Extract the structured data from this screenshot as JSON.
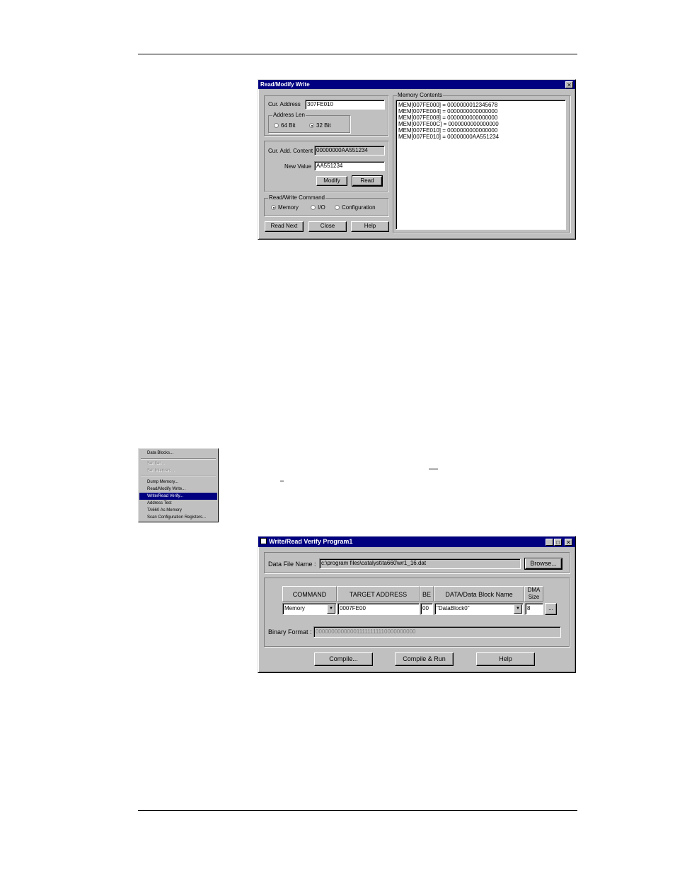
{
  "rwm": {
    "title": "Read/Modify Write",
    "close_glyph": "✕",
    "cur_address_label": "Cur. Address",
    "cur_address_value": "307FE010",
    "address_len_label": "Address Len",
    "radio_64": "64 Bit",
    "radio_32": "32 Bit",
    "cur_add_content_label": "Cur. Add. Content",
    "cur_add_content_value": "00000000AA551234",
    "new_value_label": "New Value",
    "new_value_value": "AA551234",
    "modify_label": "Modify",
    "read_label": "Read",
    "rw_command_label": "Read/Write Command",
    "radio_memory": "Memory",
    "radio_io": "I/O",
    "radio_config": "Configuration",
    "read_next_label": "Read Next",
    "close_label": "Close",
    "help_label": "Help",
    "memory_contents_label": "Memory Contents",
    "memory_lines": [
      "MEM[007FE000] = 0000000012345678",
      "MEM[007FE004] = 0000000000000000",
      "MEM[007FE008] = 0000000000000000",
      "MEM[007FE00C] = 0000000000000000",
      "MEM[007FE010] = 0000000000000000",
      "MEM[007FE010] = 00000000AA551234"
    ]
  },
  "menu": {
    "items": [
      "Data Blocks...",
      "Set Iter...",
      "Set Intervals...",
      "Dump Memory...",
      "Read/Modify Write...",
      "Write/Read Verify...",
      "Address Test",
      "TA660 As Memory",
      "Scan Configuration Registers..."
    ]
  },
  "wrv": {
    "title": "Write/Read Verify Program1",
    "min_glyph": "_",
    "max_glyph": "□",
    "close_glyph": "✕",
    "data_file_label": "Data File Name :",
    "data_file_value": "c:\\program files\\catalyst\\ta660\\wr1_16.dat",
    "browse_label": "Browse...",
    "col_command": "COMMAND",
    "col_target": "TARGET ADDRESS",
    "col_be": "BE",
    "col_data": "DATA/Data Block Name",
    "col_dma": "DMA Size",
    "command_value": "Memory",
    "target_value": "0007FE00",
    "be_value": "00",
    "data_value": "\"DataBlock0\"",
    "dma_value": "8",
    "ellipsis_label": "...",
    "binary_label": "Binary Format :",
    "binary_value": "000000000000011111111110000000000",
    "compile_label": "Compile...",
    "compile_run_label": "Compile & Run",
    "help_label": "Help"
  }
}
